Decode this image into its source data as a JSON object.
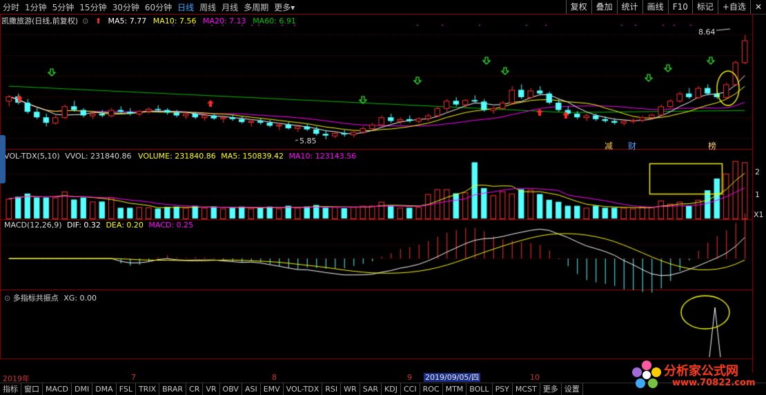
{
  "toolbar": {
    "periods": [
      "分时",
      "1分钟",
      "5分钟",
      "15分钟",
      "30分钟",
      "60分钟",
      "日线",
      "周线",
      "月线",
      "多周期",
      "更多"
    ],
    "active": "日线",
    "more_caret": "▾",
    "right": [
      "复权",
      "叠加",
      "统计",
      "画线",
      "F10",
      "标记",
      "+自选"
    ],
    "close": "✕"
  },
  "stock": {
    "title": "凯撒旅游(日线,前复权)",
    "ma5": "MA5: 7.77",
    "ma10": "MA10: 7.56",
    "ma20": "MA20: 7.13",
    "ma60": "MA60: 6.91",
    "high_label": "8.64",
    "low_label": "5.85",
    "markers": [
      "减",
      "财",
      "榜"
    ]
  },
  "volume": {
    "title": "VOL-TDX(5,10)",
    "vvol": "VVOL: 231840.86",
    "volume": "VOLUME: 231840.86",
    "ma5": "MA5: 150839.42",
    "ma10": "MA10: 123143.56",
    "axis": [
      "2",
      "1",
      "X1"
    ]
  },
  "macd": {
    "title": "MACD(12,26,9)",
    "dif": "DIF: 0.32",
    "dea": "DEA: 0.20",
    "macd": "MACD: 0.25"
  },
  "signal": {
    "title": "多指标共振点",
    "xg": "XG: 0.00"
  },
  "dates": {
    "labels": [
      "2019年",
      "7",
      "8",
      "9",
      "10"
    ],
    "highlight": "2019/09/05/四"
  },
  "tabs": [
    "指标",
    "窗口",
    "MACD",
    "DMI",
    "DMA",
    "FSL",
    "TRIX",
    "BRAR",
    "CR",
    "VR",
    "OBV",
    "ASI",
    "EMV",
    "VOL-TDX",
    "RSI",
    "WR",
    "SAR",
    "KDJ",
    "CCI",
    "ROC",
    "MTM",
    "BOLL",
    "PSY",
    "MCST",
    "更多",
    "设置"
  ],
  "watermark": {
    "text": "分析家公式网",
    "url": "www.70822.com"
  },
  "colors": {
    "up": "#ff3232",
    "down": "#54ffff",
    "ma5": "#ffffff",
    "ma10": "#ffff00",
    "ma20": "#ff00ff",
    "ma60": "#00c000",
    "grid": "#7a0000",
    "highlight": "#ffff00"
  },
  "chart_data": {
    "type": "candlestick",
    "ohlc": [
      [
        6.9,
        7.05,
        6.75,
        7.02
      ],
      [
        7.02,
        7.1,
        6.8,
        6.85
      ],
      [
        6.85,
        6.95,
        6.55,
        6.6
      ],
      [
        6.6,
        6.7,
        6.4,
        6.45
      ],
      [
        6.45,
        6.55,
        6.2,
        6.3
      ],
      [
        6.3,
        6.5,
        6.25,
        6.45
      ],
      [
        6.45,
        6.8,
        6.4,
        6.75
      ],
      [
        6.75,
        6.9,
        6.6,
        6.65
      ],
      [
        6.65,
        6.7,
        6.45,
        6.5
      ],
      [
        6.5,
        6.6,
        6.4,
        6.55
      ],
      [
        6.55,
        6.65,
        6.45,
        6.5
      ],
      [
        6.5,
        6.7,
        6.45,
        6.65
      ],
      [
        6.65,
        6.75,
        6.55,
        6.6
      ],
      [
        6.6,
        6.7,
        6.5,
        6.55
      ],
      [
        6.55,
        6.65,
        6.48,
        6.62
      ],
      [
        6.62,
        6.72,
        6.55,
        6.68
      ],
      [
        6.68,
        6.78,
        6.6,
        6.65
      ],
      [
        6.65,
        6.7,
        6.52,
        6.58
      ],
      [
        6.58,
        6.65,
        6.45,
        6.5
      ],
      [
        6.5,
        6.6,
        6.4,
        6.55
      ],
      [
        6.55,
        6.6,
        6.4,
        6.45
      ],
      [
        6.45,
        6.55,
        6.35,
        6.5
      ],
      [
        6.5,
        6.55,
        6.38,
        6.42
      ],
      [
        6.42,
        6.5,
        6.3,
        6.45
      ],
      [
        6.45,
        6.52,
        6.35,
        6.4
      ],
      [
        6.4,
        6.48,
        6.28,
        6.32
      ],
      [
        6.32,
        6.4,
        6.2,
        6.35
      ],
      [
        6.35,
        6.42,
        6.25,
        6.3
      ],
      [
        6.3,
        6.38,
        6.18,
        6.22
      ],
      [
        6.22,
        6.3,
        6.1,
        6.25
      ],
      [
        6.25,
        6.32,
        6.12,
        6.15
      ],
      [
        6.15,
        6.25,
        6.05,
        6.2
      ],
      [
        6.2,
        6.28,
        6.08,
        6.12
      ],
      [
        6.12,
        6.2,
        5.95,
        6.0
      ],
      [
        6.0,
        6.1,
        5.85,
        5.95
      ],
      [
        5.95,
        6.05,
        5.88,
        6.02
      ],
      [
        6.02,
        6.1,
        5.92,
        5.98
      ],
      [
        5.98,
        6.08,
        5.9,
        6.05
      ],
      [
        6.05,
        6.2,
        6.0,
        6.15
      ],
      [
        6.15,
        6.3,
        6.1,
        6.25
      ],
      [
        6.25,
        6.5,
        6.2,
        6.45
      ],
      [
        6.45,
        6.55,
        6.3,
        6.35
      ],
      [
        6.35,
        6.45,
        6.25,
        6.4
      ],
      [
        6.4,
        6.5,
        6.3,
        6.35
      ],
      [
        6.35,
        6.45,
        6.28,
        6.42
      ],
      [
        6.42,
        6.55,
        6.35,
        6.5
      ],
      [
        6.5,
        6.75,
        6.45,
        6.7
      ],
      [
        6.7,
        6.95,
        6.6,
        6.9
      ],
      [
        6.9,
        7.0,
        6.75,
        6.8
      ],
      [
        6.8,
        6.95,
        6.7,
        6.92
      ],
      [
        6.92,
        7.05,
        6.85,
        6.88
      ],
      [
        6.88,
        6.95,
        6.6,
        6.65
      ],
      [
        6.65,
        6.75,
        6.55,
        6.7
      ],
      [
        6.7,
        6.9,
        6.65,
        6.85
      ],
      [
        6.85,
        7.3,
        6.8,
        7.2
      ],
      [
        7.2,
        7.35,
        6.95,
        7.0
      ],
      [
        7.0,
        7.25,
        6.95,
        7.18
      ],
      [
        7.18,
        7.3,
        7.05,
        7.1
      ],
      [
        7.1,
        7.15,
        6.8,
        6.85
      ],
      [
        6.85,
        6.95,
        6.6,
        6.65
      ],
      [
        6.65,
        6.75,
        6.5,
        6.55
      ],
      [
        6.55,
        6.62,
        6.4,
        6.45
      ],
      [
        6.45,
        6.55,
        6.35,
        6.5
      ],
      [
        6.5,
        6.55,
        6.35,
        6.4
      ],
      [
        6.4,
        6.48,
        6.3,
        6.35
      ],
      [
        6.35,
        6.42,
        6.25,
        6.3
      ],
      [
        6.3,
        6.38,
        6.22,
        6.35
      ],
      [
        6.35,
        6.42,
        6.28,
        6.38
      ],
      [
        6.38,
        6.5,
        6.32,
        6.45
      ],
      [
        6.45,
        6.55,
        6.4,
        6.52
      ],
      [
        6.52,
        6.8,
        6.48,
        6.75
      ],
      [
        6.75,
        6.95,
        6.7,
        6.9
      ],
      [
        6.9,
        7.15,
        6.85,
        7.1
      ],
      [
        7.1,
        7.25,
        6.95,
        7.0
      ],
      [
        7.0,
        7.3,
        6.95,
        7.25
      ],
      [
        7.25,
        7.35,
        7.05,
        7.1
      ],
      [
        7.1,
        7.2,
        6.95,
        7.0
      ],
      [
        7.0,
        7.4,
        6.95,
        7.35
      ],
      [
        7.35,
        8.0,
        7.3,
        7.95
      ],
      [
        7.95,
        8.7,
        7.9,
        8.55
      ]
    ],
    "ma5_note": "MA5 white, MA10 yellow, MA20 magenta, MA60 green"
  }
}
